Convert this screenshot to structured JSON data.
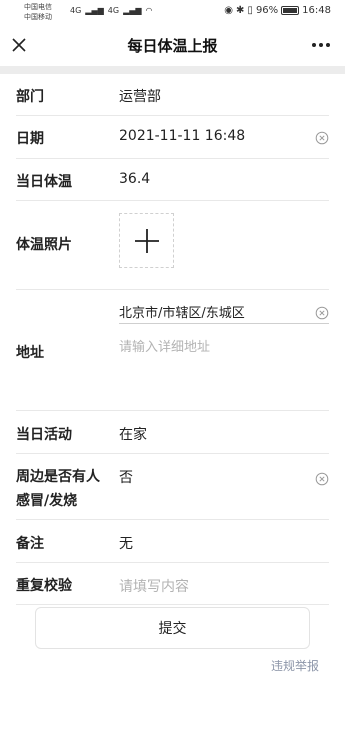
{
  "status_bar": {
    "carrier1": "中国电信",
    "carrier2": "中国移动",
    "network1": "4G",
    "network2": "4G",
    "battery_percent": "96%",
    "battery_level": 0.96,
    "time": "16:48"
  },
  "nav": {
    "title": "每日体温上报",
    "close_icon": "close-icon",
    "more_icon": "more-icon"
  },
  "form": {
    "department": {
      "label": "部门",
      "value": "运营部"
    },
    "date": {
      "label": "日期",
      "value": "2021-11-11 16:48"
    },
    "temperature": {
      "label": "当日体温",
      "value": "36.4"
    },
    "photo": {
      "label": "体温照片",
      "upload_icon": "plus-icon"
    },
    "address": {
      "label": "地址",
      "region": "北京市/市辖区/东城区",
      "detail_placeholder": "请输入详细地址"
    },
    "activity": {
      "label": "当日活动",
      "value": "在家"
    },
    "sick_nearby": {
      "label1": "周边是否有人",
      "label2": "感冒/发烧",
      "value": "否"
    },
    "remark": {
      "label": "备注",
      "value": "无"
    },
    "verify": {
      "label": "重复校验",
      "placeholder": "请填写内容"
    }
  },
  "submit_label": "提交",
  "report_label": "违规举报",
  "colors": {
    "placeholder": "#b3b3b3",
    "link": "#8c95a8",
    "divider": "#e8e8e8"
  }
}
